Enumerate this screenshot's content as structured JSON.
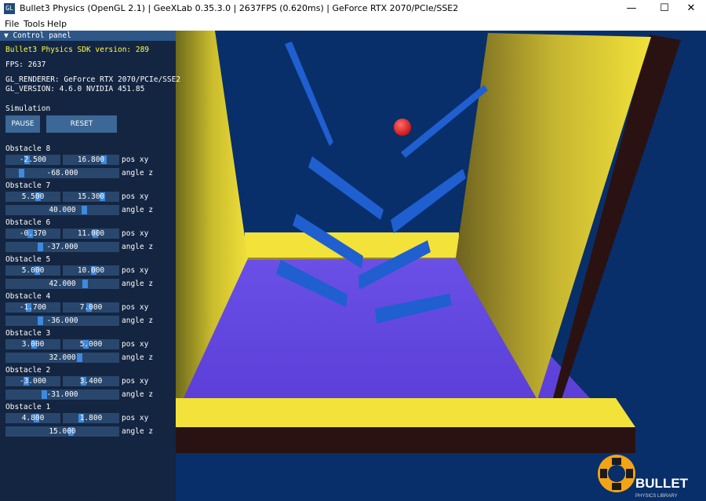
{
  "window": {
    "title": "Bullet3 Physics (OpenGL 2.1) | GeeXLab 0.35.3.0 | 2637FPS (0.620ms) | GeForce RTX 2070/PCIe/SSE2",
    "icon_text": "GL",
    "minimize_glyph": "—",
    "maximize_glyph": "☐",
    "close_glyph": "✕"
  },
  "menu": [
    "File",
    "Tools",
    "Help"
  ],
  "panel": {
    "header": "▼ Control panel",
    "sdk_version": "Bullet3 Physics SDK version: 289",
    "fps": "FPS: 2637",
    "renderer": "GL_RENDERER: GeForce RTX 2070/PCIe/SSE2",
    "version": "GL_VERSION: 4.6.0 NVIDIA 451.85",
    "simulation_label": "Simulation",
    "pause_label": "PAUSE",
    "reset_label": "RESET",
    "pos_label": "pos xy",
    "angle_label": "angle z",
    "obstacles": [
      {
        "name": "Obstacle 8",
        "pos_x": "-2.500",
        "pos_y": "16.800",
        "angle": "-68.000",
        "pos_x_level": 0.38,
        "pos_y_level": 0.76,
        "angle_level": 0.12
      },
      {
        "name": "Obstacle 7",
        "pos_x": "5.500",
        "pos_y": "15.300",
        "angle": "40.000",
        "pos_x_level": 0.6,
        "pos_y_level": 0.72,
        "angle_level": 0.7
      },
      {
        "name": "Obstacle 6",
        "pos_x": "-0.370",
        "pos_y": "11.000",
        "angle": "-37.000",
        "pos_x_level": 0.45,
        "pos_y_level": 0.58,
        "angle_level": 0.3
      },
      {
        "name": "Obstacle 5",
        "pos_x": "5.000",
        "pos_y": "10.000",
        "angle": "42.000",
        "pos_x_level": 0.58,
        "pos_y_level": 0.55,
        "angle_level": 0.71
      },
      {
        "name": "Obstacle 4",
        "pos_x": "-1.700",
        "pos_y": "7.000",
        "angle": "-36.000",
        "pos_x_level": 0.42,
        "pos_y_level": 0.46,
        "angle_level": 0.3
      },
      {
        "name": "Obstacle 3",
        "pos_x": "3.000",
        "pos_y": "5.000",
        "angle": "32.000",
        "pos_x_level": 0.53,
        "pos_y_level": 0.4,
        "angle_level": 0.66
      },
      {
        "name": "Obstacle 2",
        "pos_x": "-3.000",
        "pos_y": "3.400",
        "angle": "-31.000",
        "pos_x_level": 0.37,
        "pos_y_level": 0.36,
        "angle_level": 0.33
      },
      {
        "name": "Obstacle 1",
        "pos_x": "4.800",
        "pos_y": "1.800",
        "angle": "15.000",
        "pos_x_level": 0.57,
        "pos_y_level": 0.3,
        "angle_level": 0.58
      }
    ]
  },
  "logo_text": "BULLET",
  "logo_subtext": "PHYSICS LIBRARY",
  "colors": {
    "background": "#082f6a",
    "wall_yellow": "#f2e23a",
    "floor": "#5a40e0",
    "obstacle": "#1f5fd0",
    "ball": "#e01515",
    "panel_header": "#2e5686",
    "slider_grab": "#3d8ae0"
  }
}
